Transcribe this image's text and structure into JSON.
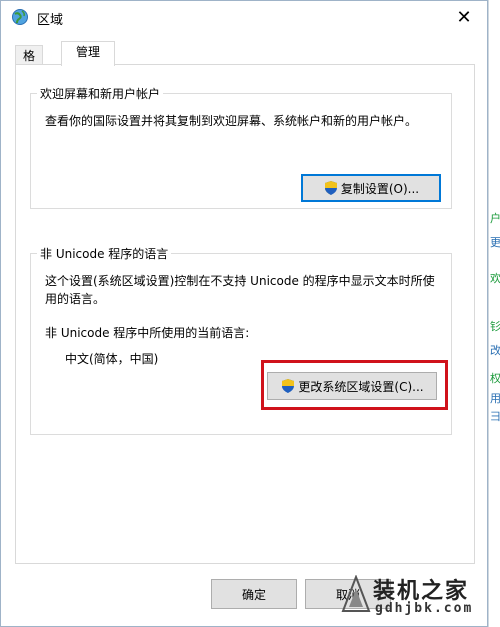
{
  "window": {
    "title": "区域",
    "close_glyph": "✕"
  },
  "tabs": [
    {
      "label": "格式",
      "active": false
    },
    {
      "label": "管理",
      "active": true
    }
  ],
  "welcome_group": {
    "title": "欢迎屏幕和新用户帐户",
    "description": "查看你的国际设置并将其复制到欢迎屏幕、系统帐户和新的用户帐户。",
    "copy_button": "复制设置(O)..."
  },
  "unicode_group": {
    "title": "非 Unicode 程序的语言",
    "description_line1": "这个设置(系统区域设置)控制在不支持 Unicode 的程序中显示文本时所使",
    "description_line2": "用的语言。",
    "current_label": "非 Unicode 程序中所使用的当前语言:",
    "current_value": "中文(简体，中国)",
    "change_button": "更改系统区域设置(C)..."
  },
  "footer": {
    "ok_label": "确定",
    "cancel_label": "取消"
  },
  "backdrop_chars": [
    "户",
    "更",
    "欢",
    "钐",
    "改",
    "权",
    "用",
    "彐"
  ],
  "watermark": {
    "text": "装机之家",
    "url": "gdhjbk.com"
  },
  "colors": {
    "highlight": "#d0121b",
    "shield_blue": "#1f5fbf",
    "shield_yellow": "#f2c21b",
    "default_button_border": "#0078d7"
  }
}
